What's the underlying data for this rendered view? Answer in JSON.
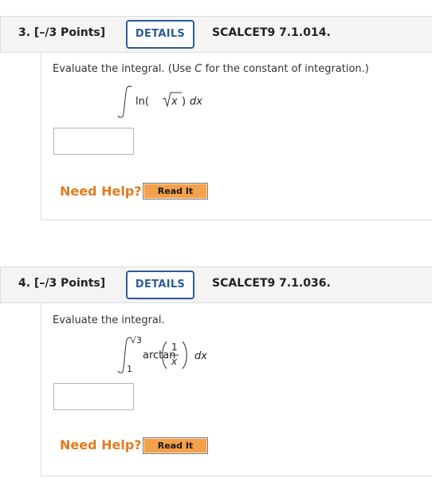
{
  "questions": [
    {
      "number": "3. [–/3 Points]",
      "details_label": "DETAILS",
      "code": "SCALCET9 7.1.014.",
      "prompt_before": "Evaluate the integral. (Use ",
      "prompt_var": "C",
      "prompt_after": " for the constant of integration.)",
      "integrand_fn": "ln(",
      "integrand_radicand": "x",
      "integrand_close": ")",
      "differential": "dx",
      "answer_value": "",
      "need_help": "Need Help?",
      "read_it": "Read It"
    },
    {
      "number": "4. [–/3 Points]",
      "details_label": "DETAILS",
      "code": "SCALCET9 7.1.036.",
      "prompt": "Evaluate the integral.",
      "upper_limit": "√3",
      "lower_limit": "1",
      "integrand_fn": "arctan",
      "frac_num": "1",
      "frac_den": "x",
      "differential": "dx",
      "answer_value": "",
      "need_help": "Need Help?",
      "read_it": "Read It"
    }
  ]
}
